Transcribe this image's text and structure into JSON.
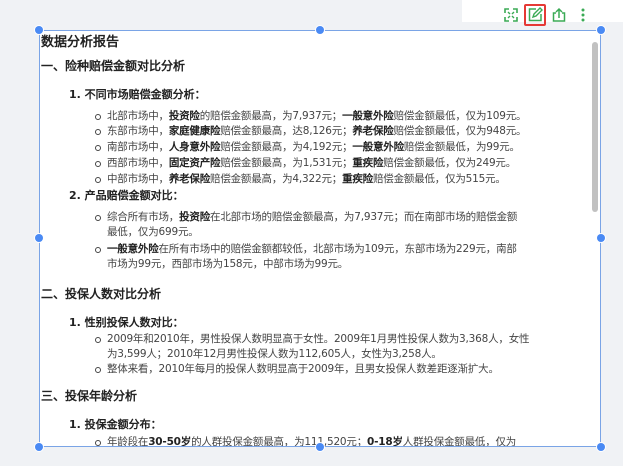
{
  "toolbar": {
    "icons": [
      "fullscreen-icon",
      "edit-icon",
      "export-icon",
      "more-vertical-icon"
    ],
    "accent": "#3aaa55",
    "active_border": "#e53935"
  },
  "report": {
    "title": "数据分析报告",
    "s1": {
      "heading": "一、险种赔偿金额对比分析",
      "sub1": "1. 不同市场赔偿金额分析：",
      "items1": [
        {
          "a": "北部市场中，",
          "b": "投资险",
          "c": "的赔偿金额最高，为7,937元；",
          "d": "一般意外险",
          "e": "赔偿金额最低，仅为109元。"
        },
        {
          "a": "东部市场中，",
          "b": "家庭健康险",
          "c": "赔偿金额最高，达8,126元；",
          "d": "养老保险",
          "e": "赔偿金额最低，仅为948元。"
        },
        {
          "a": "南部市场中，",
          "b": "人身意外险",
          "c": "赔偿金额最高，为4,192元；",
          "d": "一般意外险",
          "e": "赔偿金额最低，为99元。"
        },
        {
          "a": "西部市场中，",
          "b": "固定资产险",
          "c": "赔偿金额最高，为1,531元；",
          "d": "重疾险",
          "e": "赔偿金额最低，仅为249元。"
        },
        {
          "a": "中部市场中，",
          "b": "养老保险",
          "c": "赔偿金额最高，为4,322元；",
          "d": "重疾险",
          "e": "赔偿金额最低，仅为515元。"
        }
      ],
      "sub2": "2. 产品赔偿金额对比：",
      "items2": [
        {
          "a": "综合所有市场，",
          "b": "投资险",
          "c": "在北部市场的赔偿金额最高，为7,937元；而在南部市场的赔偿金额",
          "line2": "最低，仅为699元。"
        },
        {
          "a": "",
          "b": "一般意外险",
          "c": "在所有市场中的赔偿金额都较低，北部市场为109元，东部市场为229元，南部",
          "line2": "市场为99元，西部市场为158元，中部市场为99元。"
        }
      ]
    },
    "s2": {
      "heading": "二、投保人数对比分析",
      "sub1": "1. 性别投保人数对比：",
      "item1_line1": "2009年和2010年，男性投保人数明显高于女性。2009年1月男性投保人数为3,368人，女性",
      "item1_line2": "为3,599人；2010年12月男性投保人数为112,605人，女性为3,258人。",
      "item2": "整体来看，2010年每月的投保人数明显高于2009年，且男女投保人数差距逐渐扩大。"
    },
    "s3": {
      "heading": "三、投保年龄分析",
      "sub1": "1. 投保金额分布：",
      "item1": {
        "a": "年龄段在",
        "b": "30-50岁",
        "c": "的人群投保金额最高，为111,520元；",
        "d": "0-18岁",
        "e": "人群投保金额最低，仅为"
      }
    }
  }
}
